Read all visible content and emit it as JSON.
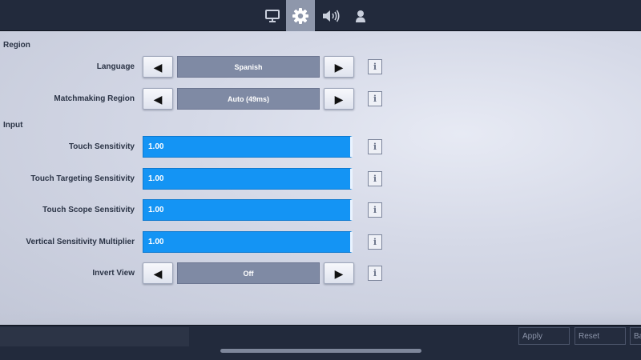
{
  "tabs": [
    {
      "name": "display",
      "icon": "monitor-icon",
      "active": false
    },
    {
      "name": "settings",
      "icon": "gear-icon",
      "active": true
    },
    {
      "name": "audio",
      "icon": "speaker-icon",
      "active": false
    },
    {
      "name": "account",
      "icon": "person-icon",
      "active": false
    }
  ],
  "sections": {
    "region": {
      "title": "Region",
      "language": {
        "label": "Language",
        "value": "Spanish"
      },
      "matchmaking": {
        "label": "Matchmaking Region",
        "value": "Auto (49ms)"
      }
    },
    "input": {
      "title": "Input",
      "touch_sensitivity": {
        "label": "Touch Sensitivity",
        "value": "1.00"
      },
      "touch_targeting": {
        "label": "Touch Targeting Sensitivity",
        "value": "1.00"
      },
      "touch_scope": {
        "label": "Touch Scope Sensitivity",
        "value": "1.00"
      },
      "vertical_multiplier": {
        "label": "Vertical Sensitivity Multiplier",
        "value": "1.00"
      },
      "invert_view": {
        "label": "Invert View",
        "value": "Off"
      }
    }
  },
  "glyphs": {
    "left_arrow": "◀",
    "right_arrow": "▶",
    "info": "i"
  },
  "footer": {
    "apply": "Apply",
    "reset": "Reset",
    "back": "Ba"
  },
  "colors": {
    "slider_fill": "#1494f4",
    "value_box": "#7f8aa4",
    "active_tab": "#8e97ab"
  }
}
